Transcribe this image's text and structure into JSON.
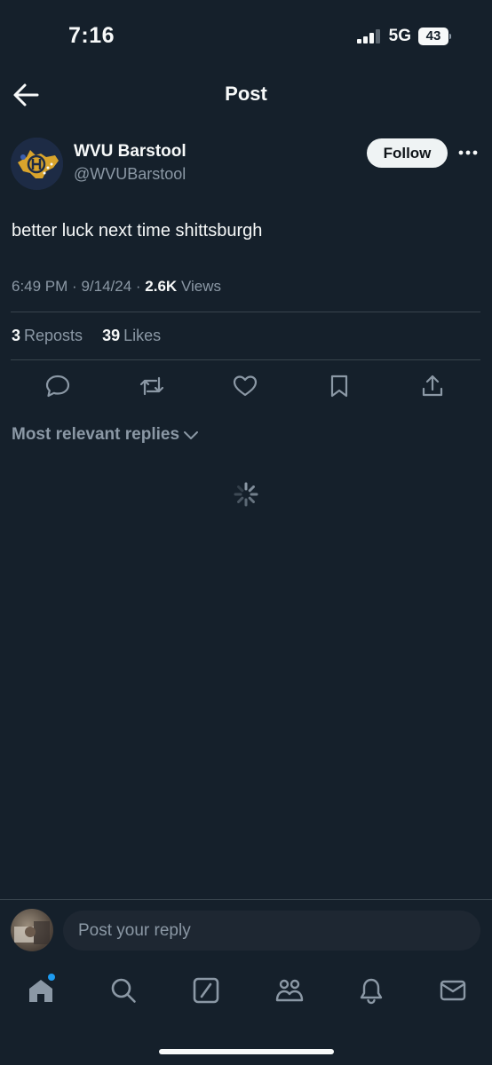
{
  "status_bar": {
    "time": "7:16",
    "network": "5G",
    "battery": "43"
  },
  "header": {
    "title": "Post"
  },
  "post": {
    "author_name": "WVU Barstool",
    "author_handle": "@WVUBarstool",
    "follow_label": "Follow",
    "text": "better luck next time shittsburgh",
    "time": "6:49 PM",
    "date": "9/14/24",
    "views_count": "2.6K",
    "views_label": "Views",
    "reposts_count": "3",
    "reposts_label": "Reposts",
    "likes_count": "39",
    "likes_label": "Likes"
  },
  "replies": {
    "filter_label": "Most relevant replies"
  },
  "reply_bar": {
    "placeholder": "Post your reply"
  },
  "icons": {
    "back": "back-arrow-icon",
    "more": "more-dots-icon",
    "reply": "reply-icon",
    "repost": "repost-icon",
    "like": "heart-icon",
    "bookmark": "bookmark-icon",
    "share": "share-icon",
    "nav": [
      "home-icon",
      "search-icon",
      "grok-icon",
      "communities-icon",
      "notifications-icon",
      "messages-icon"
    ]
  },
  "colors": {
    "background": "#15202b",
    "accent": "#1d9bf0",
    "muted_text": "#8b98a5"
  }
}
